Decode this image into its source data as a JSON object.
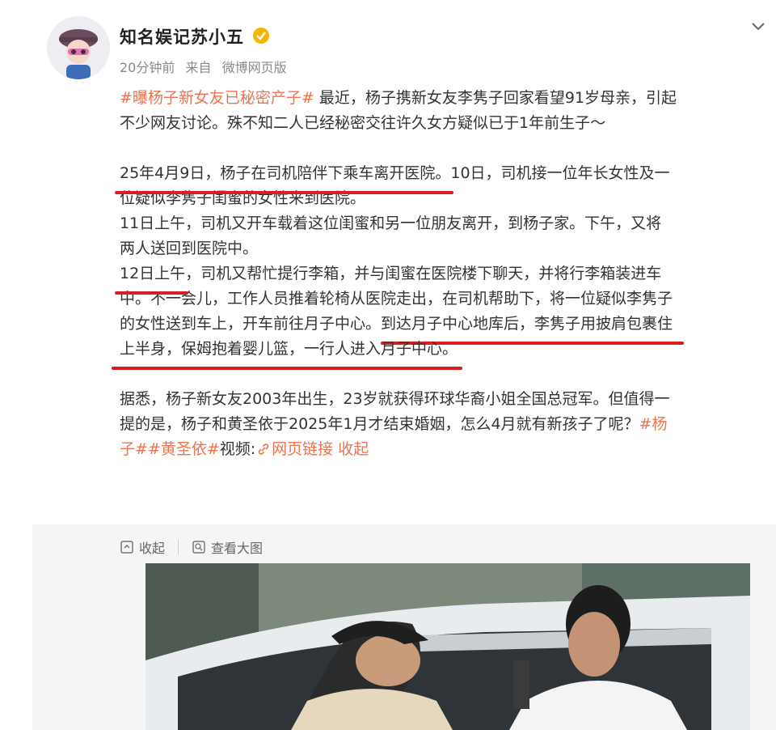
{
  "author": {
    "name": "知名娱记苏小五",
    "time": "20分钟前",
    "source_prefix": "来自",
    "source": "微博网页版"
  },
  "post": {
    "p1_hashtag": "#曝杨子新女友已秘密产子#",
    "p1_line1_rest": " 最近，杨子携新女友李隽子回家看望91岁母亲，引起",
    "p1_line2": "不少网友讨论。殊不知二人已经秘密交往许久女方疑似已于1年前生子～",
    "p2_underlined": "25年4月9日，杨子在司机陪伴下乘车离开医院。",
    "p2_rest": "10日，司机接一位年长女性及一",
    "p2_line2": "位疑似李隽子闺蜜的女性来到医院。",
    "p3_line1": "11日上午，司机又开车载着这位闺蜜和另一位朋友离开，到杨子家。下午，又将",
    "p3_line2": "两人送回到医院中。",
    "p4_underlined": "12日上午",
    "p4_rest": "，司机又帮忙提行李箱，并与闺蜜在医院楼下聊天，并将行李箱装进车",
    "p4_line2": "中。不一会儿，工作人员推着轮椅从医院走出，在司机帮助下，将一位疑似李隽子",
    "p4_line3_a": "的女性送到车上，开车前往月子中心。",
    "p4_line3_b": "到达月子中心地库后，李隽子用披肩包裹住",
    "p4_line4": "上半身，保姆抱着婴儿篮，一行人进入月子中心。",
    "p5_line1": "据悉，杨子新女友2003年出生，23岁就获得环球华裔小姐全国总冠军。但值得一",
    "p5_line2_a": "提的是，杨子和黄圣依于2025年1月才结束婚姻，怎么4月就有新孩子了呢？",
    "p5_hashtag1_a": "#杨",
    "p5_hashtag1_b": "子#",
    "p5_hashtag2": "#黄圣依#",
    "p5_video_label": "视频:",
    "p5_link": "网页链接",
    "p5_collapse": "收起"
  },
  "media_toolbar": {
    "collapse_label": "收起",
    "view_large_label": "查看大图"
  },
  "icons": {
    "verified": "verified-badge-icon",
    "chevron": "chevron-down-icon",
    "link": "link-icon",
    "collapse": "collapse-icon",
    "zoom": "zoom-in-icon"
  },
  "colors": {
    "hashtag": "#eb7350",
    "underline_annotation": "#d81e1e",
    "meta_gray": "#8a8a8a"
  }
}
